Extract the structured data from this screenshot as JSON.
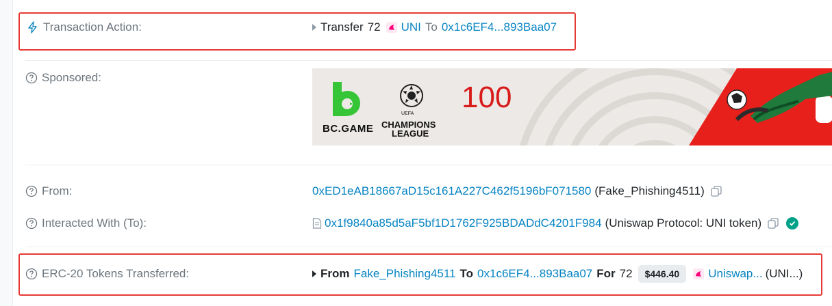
{
  "action": {
    "label": "Transaction Action:",
    "verb": "Transfer",
    "amount": "72",
    "token": "UNI",
    "to_word": "To",
    "to_address": "0x1c6EF4...893Baa07"
  },
  "sponsored": {
    "label": "Sponsored:",
    "brand": "BC.GAME",
    "league_line1": "CHAMPIONS",
    "league_line2": "LEAGUE",
    "league_top": "UEFA",
    "promo_number": "100"
  },
  "from": {
    "label": "From:",
    "address": "0xED1eAB18667aD15c161A227C462f5196bF071580",
    "name": "(Fake_Phishing4511)"
  },
  "interacted": {
    "label": "Interacted With (To):",
    "address": "0x1f9840a85d5aF5bf1D1762F925BDADdC4201F984",
    "name": "(Uniswap Protocol: UNI token)"
  },
  "erc20": {
    "label": "ERC-20 Tokens Transferred:",
    "from_word": "From",
    "from_name": "Fake_Phishing4511",
    "to_word": "To",
    "to_address": "0x1c6EF4...893Baa07",
    "for_word": "For",
    "amount": "72",
    "price": "$446.40",
    "token_name": "Uniswap...",
    "token_symbol": "(UNI...)"
  },
  "colors": {
    "link": "#0784c3",
    "highlight_border": "#e53935",
    "verified": "#00a186",
    "banner_red": "#e8201b"
  }
}
